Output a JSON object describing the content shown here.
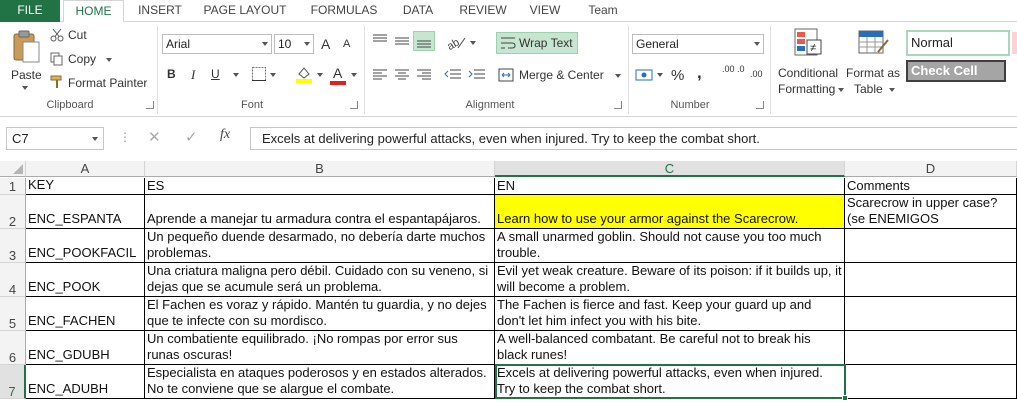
{
  "tabs": [
    "FILE",
    "HOME",
    "INSERT",
    "PAGE LAYOUT",
    "FORMULAS",
    "DATA",
    "REVIEW",
    "VIEW",
    "Team"
  ],
  "clipboard": {
    "paste": "Paste",
    "cut": "Cut",
    "copy": "Copy",
    "format_painter": "Format Painter",
    "label": "Clipboard"
  },
  "font": {
    "name": "Arial",
    "size": "10",
    "label": "Font",
    "bold": "B",
    "italic": "I",
    "underline": "U",
    "grow": "A",
    "shrink": "A"
  },
  "alignment": {
    "wrap_text": "Wrap Text",
    "merge_center": "Merge & Center",
    "label": "Alignment"
  },
  "number": {
    "format": "General",
    "label": "Number",
    "percent": "%",
    "comma": ",",
    "inc_dec": ".00 .0",
    "dec_dec": ".00"
  },
  "styles": {
    "conditional": "Conditional",
    "formatting": "Formatting",
    "format_as": "Format as",
    "table": "Table",
    "normal": "Normal",
    "check_cell": "Check Cell"
  },
  "formula_bar": {
    "name_box": "C7",
    "fx": "fx",
    "content": "Excels at delivering powerful attacks, even when injured. Try to keep the combat short."
  },
  "columns": [
    "A",
    "B",
    "C",
    "D"
  ],
  "rows": [
    {
      "num": "1",
      "a": "KEY",
      "b": "ES",
      "c": "EN",
      "d": "Comments"
    },
    {
      "num": "2",
      "a": "ENC_ESPANTA",
      "b": "Aprende a manejar tu armadura contra el espantapájaros.",
      "c": "Learn how to use your armor against the Scarecrow.",
      "d": "Scarecrow in upper case? (se ENEMIGOS"
    },
    {
      "num": "3",
      "a": "ENC_POOKFACIL",
      "b": "Un pequeño duende desarmado, no debería darte muchos problemas.",
      "c": "A small unarmed goblin. Should not cause you too much trouble.",
      "d": ""
    },
    {
      "num": "4",
      "a": "ENC_POOK",
      "b": "Una criatura maligna pero débil. Cuidado con su veneno, si dejas que se acumule será un problema.",
      "c": "Evil yet weak creature. Beware of its poison: if it builds up, it will become a problem.",
      "d": ""
    },
    {
      "num": "5",
      "a": "ENC_FACHEN",
      "b": "El Fachen es voraz y rápido. Mantén tu guardia, y no dejes que te infecte con su mordisco.",
      "c": "The Fachen is fierce and fast. Keep your guard up and don't let him infect you with his bite.",
      "d": ""
    },
    {
      "num": "6",
      "a": "ENC_GDUBH",
      "b": "Un combatiente equilibrado. ¡No rompas por error sus runas oscuras!",
      "c": "A well-balanced combatant. Be careful not to break his black runes!",
      "d": ""
    },
    {
      "num": "7",
      "a": "ENC_ADUBH",
      "b": "Especialista en ataques poderosos y en estados alterados. No te conviene que se alargue el combate.",
      "c": "Excels at delivering powerful attacks, even when injured. Try to keep the combat short.",
      "d": ""
    }
  ],
  "colors": {
    "accent": "#217346",
    "highlight": "#ffff00"
  }
}
